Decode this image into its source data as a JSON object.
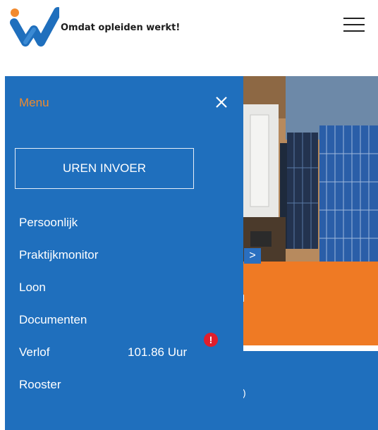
{
  "header": {
    "tagline": "Omdat opleiden werkt!",
    "logo_icon": "brand-w-logo",
    "menu_icon": "hamburger-icon"
  },
  "drawer": {
    "title": "Menu",
    "close_icon": "close-icon",
    "primary_button": "UREN INVOER",
    "items": [
      {
        "label": "Persoonlijk"
      },
      {
        "label": "Praktijkmonitor"
      },
      {
        "label": "Loon"
      },
      {
        "label": "Documenten"
      },
      {
        "label": "Verlof",
        "value": "101.86 Uur",
        "badge": "!"
      },
      {
        "label": "Rooster"
      }
    ]
  },
  "background": {
    "carousel_next_icon": "chevron-right-icon",
    "next_glyph": ">",
    "partial_mark": ")"
  },
  "colors": {
    "drawer_blue": "#1f6fbd",
    "menu_title_orange": "#ef8a2c",
    "orange_band": "#ef7a24",
    "alert_red": "#e01e2c"
  }
}
